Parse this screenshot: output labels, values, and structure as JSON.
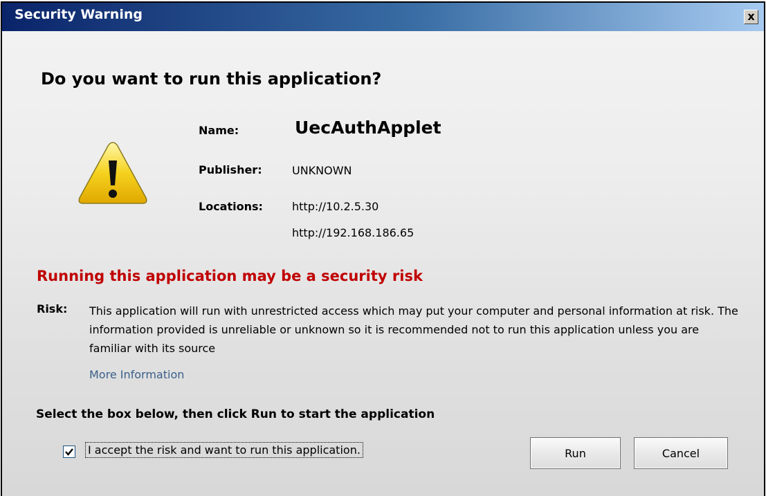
{
  "window": {
    "title": "Security Warning",
    "close_glyph": "x"
  },
  "question": "Do you want to run this application?",
  "icon": "warning-triangle-icon",
  "details": {
    "name_label": "Name:",
    "name_value": "UecAuthApplet",
    "publisher_label": "Publisher:",
    "publisher_value": "UNKNOWN",
    "locations_label": "Locations:",
    "locations": [
      "http://10.2.5.30",
      "http://192.168.186.65"
    ]
  },
  "risk": {
    "heading": "Running this application may be a security risk",
    "label": "Risk:",
    "text": "This application will run with unrestricted access which may put your computer and personal information at risk. The information provided is unreliable or unknown so it is recommended not to run this application unless you are familiar with its source",
    "more_info": "More Information"
  },
  "instruction": "Select the box below, then click Run to start the application",
  "accept": {
    "label": "I accept the risk and want to run this application.",
    "checked": true
  },
  "buttons": {
    "run": "Run",
    "cancel": "Cancel"
  },
  "colors": {
    "title_gradient_start": "#0a246a",
    "title_gradient_end": "#a6caf0",
    "risk_heading": "#c00000",
    "link": "#3a5f8a",
    "warning_yellow": "#f5d21e"
  }
}
